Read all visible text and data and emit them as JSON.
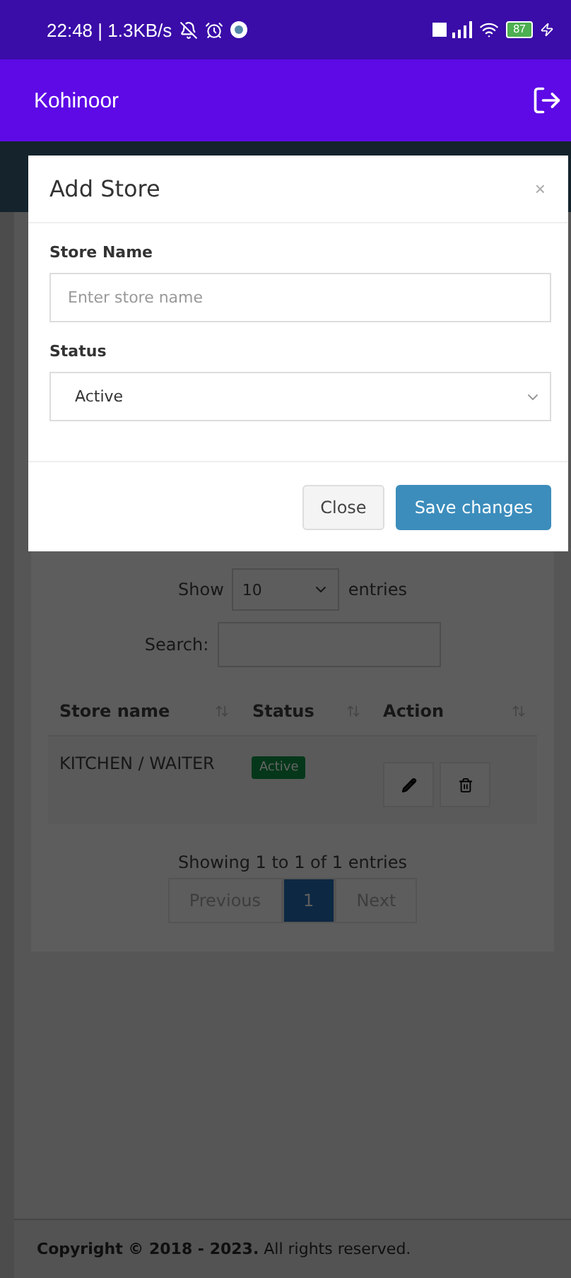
{
  "status_bar": {
    "time": "22:48 | 1.3KB/s",
    "battery": "87"
  },
  "app_bar": {
    "title": "Kohinoor"
  },
  "modal": {
    "title": "Add Store",
    "close": "×",
    "fields": [
      {
        "kind": "text",
        "label": "Store Name",
        "placeholder": "Enter store name"
      },
      {
        "kind": "select",
        "label": "Status",
        "value": "Active"
      }
    ],
    "buttons": [
      {
        "kind": "default",
        "label": "Close"
      },
      {
        "kind": "primary",
        "label": "Save changes"
      }
    ]
  },
  "table_controls": {
    "show_label": "Show",
    "length": "10",
    "entries_label": "entries",
    "search_label": "Search:"
  },
  "table": {
    "columns": [
      "Store name",
      "Status",
      "Action"
    ],
    "rows": [
      {
        "store_name": "KITCHEN / WAITER",
        "status": "Active"
      }
    ]
  },
  "info": "Showing 1 to 1 of 1 entries",
  "pagination": [
    {
      "label": "Previous",
      "selected": false,
      "disabled": true
    },
    {
      "label": "1",
      "selected": true,
      "disabled": false
    },
    {
      "label": "Next",
      "selected": false,
      "disabled": true
    }
  ],
  "footer": "**Copyright © 2018 - 2023.** All rights reserved."
}
